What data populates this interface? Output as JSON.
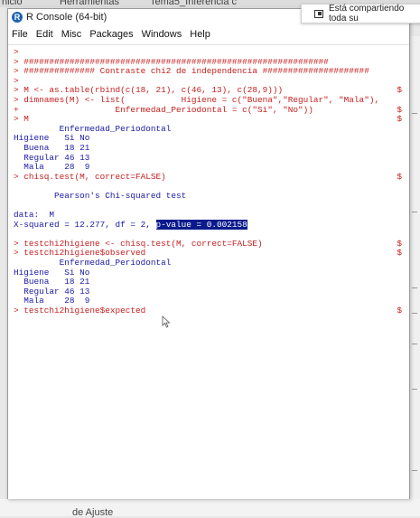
{
  "background": {
    "tabs": [
      "nicio",
      "Herramientas",
      "Tema5_Inferencia c"
    ],
    "bottom_text": "de Ajuste"
  },
  "sharing": {
    "text": "Está compartiendo toda su"
  },
  "window": {
    "title": "R Console (64-bit)",
    "icon_letter": "R",
    "menu": [
      "File",
      "Edit",
      "Misc",
      "Packages",
      "Windows",
      "Help"
    ]
  },
  "console": {
    "lines": [
      {
        "type": "in",
        "text": ">",
        "cont": ""
      },
      {
        "type": "in",
        "text": "> ############################################################",
        "cont": ""
      },
      {
        "type": "in",
        "text": "> ############## Contraste chi2 de independencia #####################",
        "cont": ""
      },
      {
        "type": "in",
        "text": ">",
        "cont": ""
      },
      {
        "type": "in",
        "text": "> M <- as.table(rbind(c(18, 21), c(46, 13), c(28,9)))",
        "cont": "$"
      },
      {
        "type": "in",
        "text": "> dimnames(M) <- list(           Higiene = c(\"Buena\",\"Regular\", \"Mala\"),",
        "cont": ""
      },
      {
        "type": "in",
        "text": "+                   Enfermedad_Periodontal = c(\"Si\", \"No\"))",
        "cont": "$"
      },
      {
        "type": "in",
        "text": "> M",
        "cont": "$"
      },
      {
        "type": "out",
        "text": "         Enfermedad_Periodontal",
        "cont": ""
      },
      {
        "type": "out",
        "text": "Higiene   Si No",
        "cont": ""
      },
      {
        "type": "out",
        "text": "  Buena   18 21",
        "cont": ""
      },
      {
        "type": "out",
        "text": "  Regular 46 13",
        "cont": ""
      },
      {
        "type": "out",
        "text": "  Mala    28  9",
        "cont": ""
      },
      {
        "type": "in",
        "text": "> chisq.test(M, correct=FALSE)",
        "cont": "$"
      },
      {
        "type": "out",
        "text": "",
        "cont": ""
      },
      {
        "type": "out",
        "text": "        Pearson's Chi-squared test",
        "cont": ""
      },
      {
        "type": "out",
        "text": "",
        "cont": ""
      },
      {
        "type": "out",
        "text": "data:  M",
        "cont": ""
      },
      {
        "type": "out",
        "text": "X-squared = 12.277, df = 2, ",
        "highlight": "p-value = 0.002158",
        "cont": ""
      },
      {
        "type": "out",
        "text": "",
        "cont": ""
      },
      {
        "type": "in",
        "text": "> testchi2higiene <- chisq.test(M, correct=FALSE)",
        "cont": "$"
      },
      {
        "type": "in",
        "text": "> testchi2higiene$observed",
        "cont": "$"
      },
      {
        "type": "out",
        "text": "         Enfermedad_Periodontal",
        "cont": ""
      },
      {
        "type": "out",
        "text": "Higiene   Si No",
        "cont": ""
      },
      {
        "type": "out",
        "text": "  Buena   18 21",
        "cont": ""
      },
      {
        "type": "out",
        "text": "  Regular 46 13",
        "cont": ""
      },
      {
        "type": "out",
        "text": "  Mala    28  9",
        "cont": ""
      },
      {
        "type": "in",
        "text": "> testchi2higiene$expected",
        "cont": "$"
      }
    ]
  }
}
